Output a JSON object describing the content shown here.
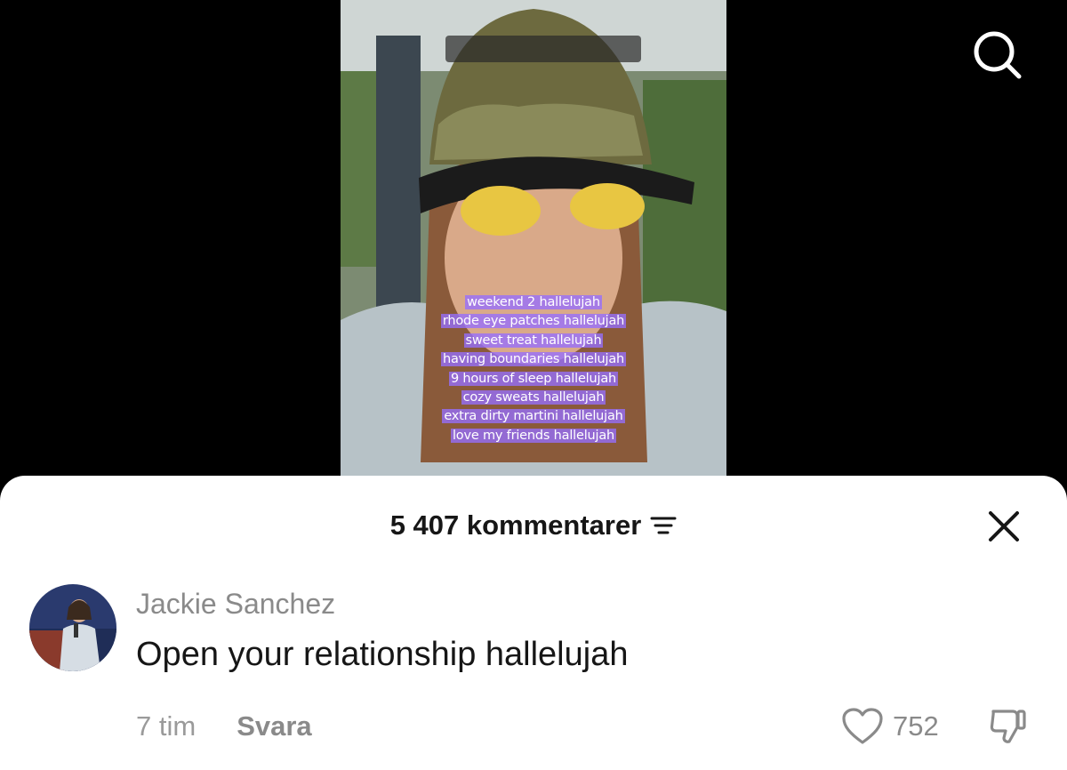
{
  "video": {
    "overlay_lines": [
      "weekend 2 hallelujah",
      "rhode eye patches hallelujah",
      "sweet treat hallelujah",
      "having boundaries hallelujah",
      "9 hours of sleep hallelujah",
      "cozy sweats hallelujah",
      "extra dirty martini hallelujah",
      "love my friends hallelujah"
    ],
    "overlay_highlight_color": "#9a72ff"
  },
  "top_bar": {
    "search_icon": "search-icon"
  },
  "comments_sheet": {
    "count_label": "5 407 kommentarer",
    "filter_icon": "sort-filter-icon",
    "close_icon": "close-icon"
  },
  "comment": {
    "username": "Jackie Sanchez",
    "text": "Open your relationship hallelujah",
    "time": "7 tim",
    "reply_label": "Svara",
    "like_count": "752",
    "like_icon": "heart-icon",
    "dislike_icon": "thumbs-down-icon"
  },
  "colors": {
    "background": "#000000",
    "sheet": "#ffffff",
    "primary_text": "#161616",
    "secondary_text": "#8a8a8a"
  }
}
